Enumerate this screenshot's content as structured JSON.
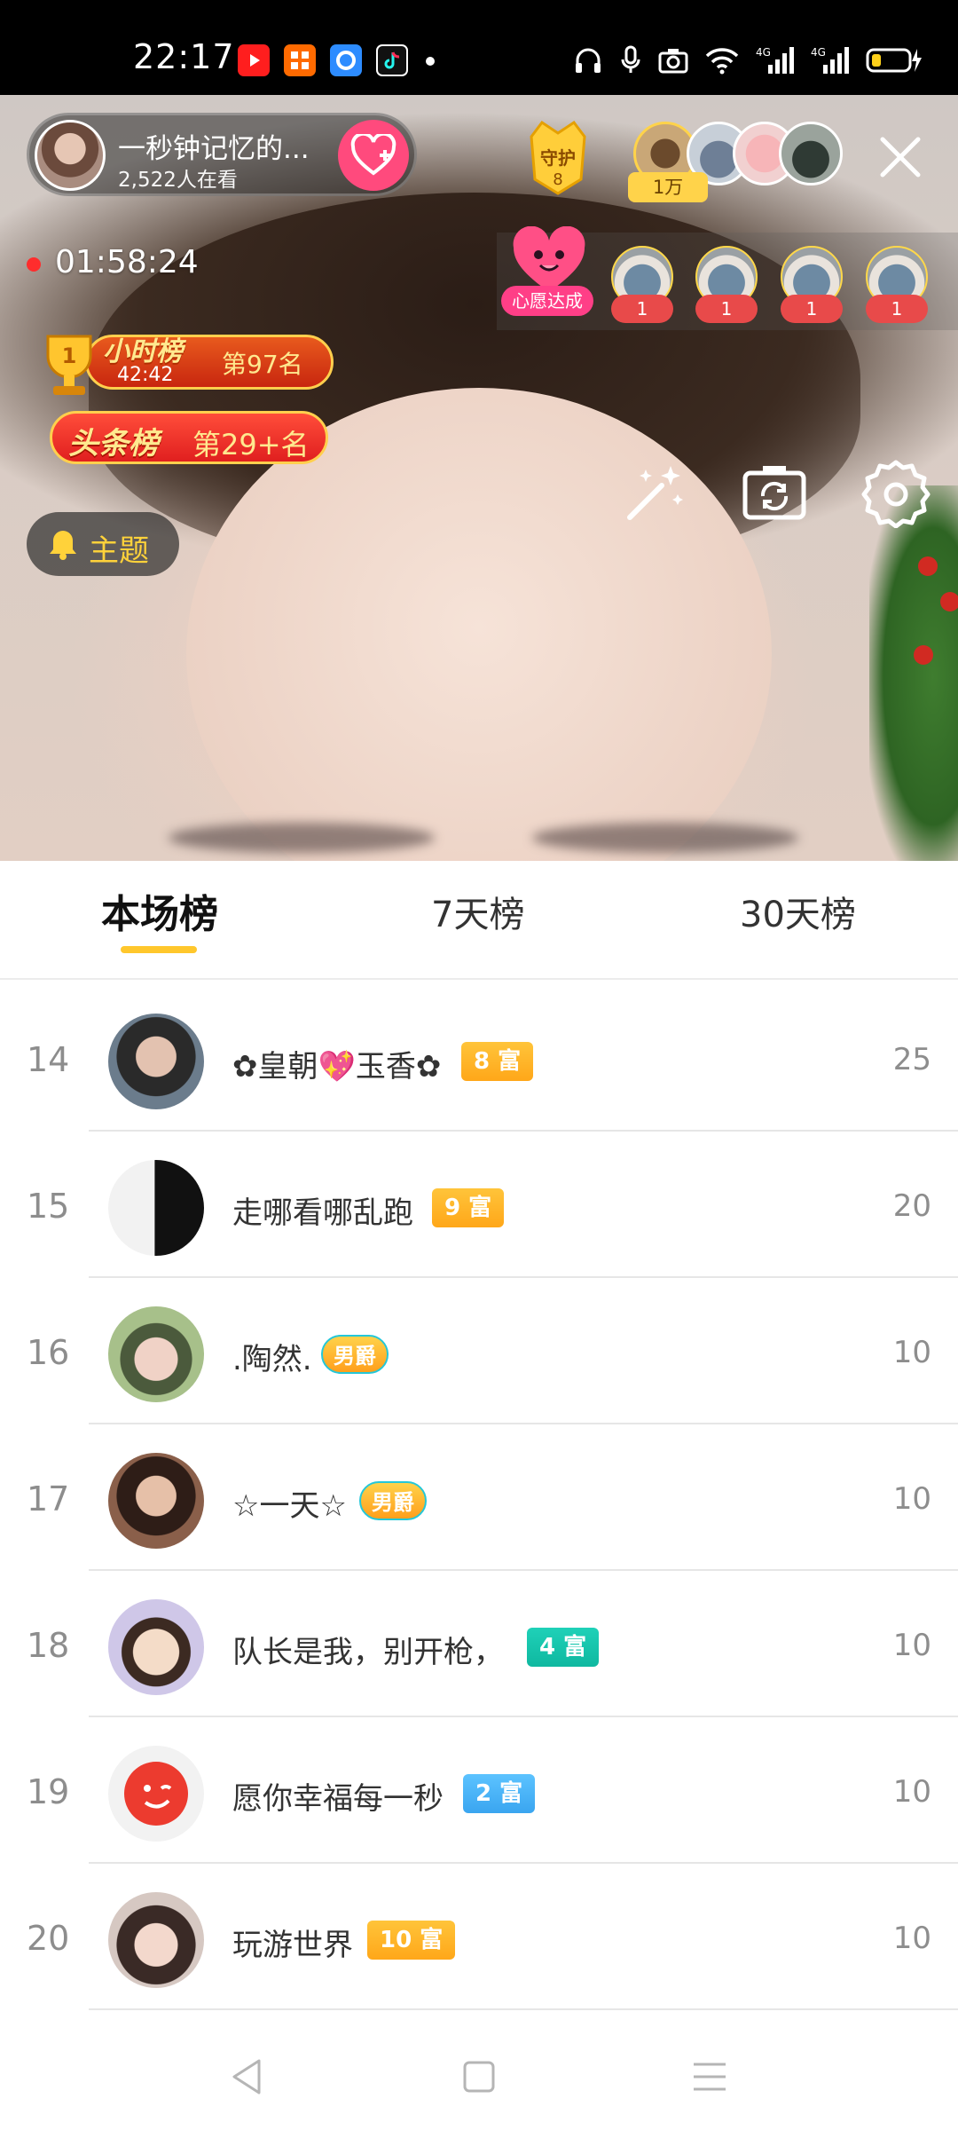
{
  "status_bar": {
    "time": "22:17"
  },
  "stream": {
    "host_name": "一秒钟记忆的...",
    "viewer_count": "2,522人在看",
    "guard_label": "守护",
    "guard_count": "8",
    "fans_count": "1万",
    "live_duration": "01:58:24",
    "wish_label": "心愿达成",
    "gift_counts": [
      "1",
      "1",
      "1",
      "1"
    ],
    "hour_rank_title": "小时榜",
    "hour_rank_time": "42:42",
    "hour_rank_place": "第97名",
    "headline_title": "头条榜",
    "headline_place": "第29+名",
    "topic_label": "主题"
  },
  "tabs": [
    {
      "label": "本场榜",
      "active": true
    },
    {
      "label": "7天榜",
      "active": false
    },
    {
      "label": "30天榜",
      "active": false
    }
  ],
  "ranking": [
    {
      "rank": "14",
      "name": "✿皇朝💖玉香✿",
      "badge": "8 富",
      "badge_type": "rich-gold",
      "score": "25"
    },
    {
      "rank": "15",
      "name": "走哪看哪乱跑",
      "badge": "9 富",
      "badge_type": "rich-gold",
      "score": "20"
    },
    {
      "rank": "16",
      "name": ".陶然.",
      "badge": "男爵",
      "badge_type": "noble",
      "score": "10"
    },
    {
      "rank": "17",
      "name": "☆一天☆",
      "badge": "男爵",
      "badge_type": "noble",
      "score": "10"
    },
    {
      "rank": "18",
      "name": "队长是我，别开枪，",
      "badge": "4 富",
      "badge_type": "rich-teal",
      "score": "10"
    },
    {
      "rank": "19",
      "name": "愿你幸福每一秒",
      "badge": "2 富",
      "badge_type": "rich-blue",
      "score": "10"
    },
    {
      "rank": "20",
      "name": "玩游世界",
      "badge": "10 富",
      "badge_type": "rich-gold",
      "score": "10"
    }
  ],
  "colors": {
    "accent": "#ffc72c",
    "follow": "#ff4a7d",
    "rich_gold": "#ffb020",
    "rich_teal": "#16c4aa",
    "rich_blue": "#46b0f5"
  },
  "icons": {
    "status": [
      "youtube-icon",
      "app-icon",
      "browser-icon",
      "tiktok-icon",
      "headphones-icon",
      "microphone-icon",
      "camera-icon",
      "wifi-icon",
      "signal-4g-icon",
      "battery-icon"
    ],
    "tools": [
      "magic-wand-icon",
      "flip-camera-icon",
      "gear-icon"
    ],
    "nav": [
      "back-icon",
      "home-icon",
      "menu-icon"
    ]
  }
}
